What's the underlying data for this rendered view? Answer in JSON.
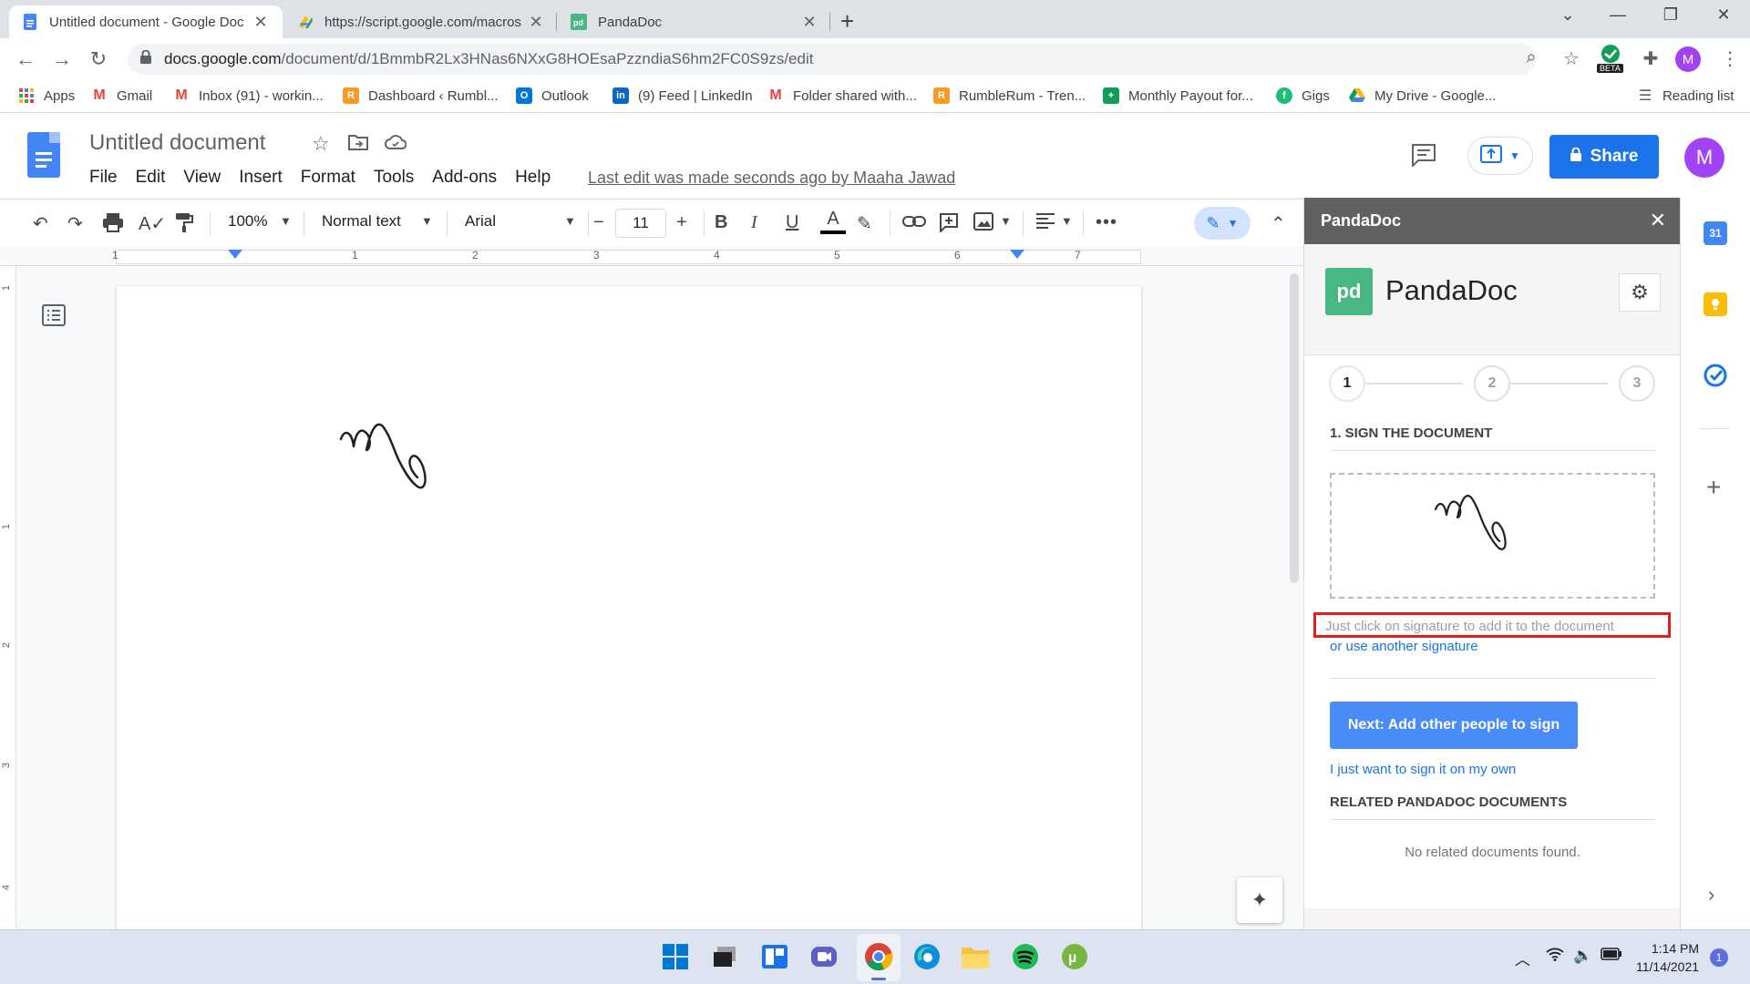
{
  "browser": {
    "tabs": [
      {
        "title": "Untitled document - Google Doc",
        "active": true
      },
      {
        "title": "https://script.google.com/macros",
        "active": false
      },
      {
        "title": "PandaDoc",
        "active": false
      }
    ],
    "url_host": "docs.google.com",
    "url_path": "/document/d/1BmmbR2Lx3HNas6NXxG8HOEsaPzzndiaS6hm2FC0S9zs/edit",
    "extension_badge": "BETA",
    "profile_initial": "M",
    "bookmarks": [
      {
        "label": "Apps",
        "icon": "apps-grid-icon",
        "color": "#4285f4"
      },
      {
        "label": "Gmail",
        "icon": "gmail-icon",
        "color": "#ea4335"
      },
      {
        "label": "Inbox (91) - workin...",
        "icon": "gmail-icon",
        "color": "#ea4335"
      },
      {
        "label": "Dashboard ‹ Rumbl...",
        "icon": "rumble-icon",
        "color": "#f59b23"
      },
      {
        "label": "Outlook",
        "icon": "outlook-icon",
        "color": "#0078d4"
      },
      {
        "label": "(9) Feed | LinkedIn",
        "icon": "linkedin-icon",
        "color": "#0a66c2"
      },
      {
        "label": "Folder shared with...",
        "icon": "gmail-icon",
        "color": "#ea4335"
      },
      {
        "label": "RumbleRum - Tren...",
        "icon": "rumble-icon",
        "color": "#f59b23"
      },
      {
        "label": "Monthly Payout for...",
        "icon": "sheets-icon",
        "color": "#0f9d58"
      },
      {
        "label": "Gigs",
        "icon": "gigs-icon",
        "color": "#1dbf73"
      },
      {
        "label": "My Drive - Google...",
        "icon": "drive-icon",
        "color": "#fbbc04"
      }
    ],
    "reading_list": "Reading list"
  },
  "docs": {
    "title": "Untitled document",
    "menus": [
      "File",
      "Edit",
      "View",
      "Insert",
      "Format",
      "Tools",
      "Add-ons",
      "Help"
    ],
    "last_edit": "Last edit was made seconds ago by Maaha Jawad",
    "share_label": "Share",
    "avatar_initial": "M",
    "toolbar": {
      "zoom": "100%",
      "style": "Normal text",
      "font": "Arial",
      "font_size": "11",
      "bold": "B",
      "italic": "I",
      "underline": "U",
      "text_color": "A"
    },
    "ruler_numbers": [
      "1",
      "1",
      "2",
      "3",
      "4",
      "5",
      "6",
      "7"
    ],
    "vruler_numbers": [
      "1",
      "1",
      "2",
      "3",
      "4"
    ]
  },
  "pandadoc": {
    "panel_title": "PandaDoc",
    "brand_name": "PandaDoc",
    "logo_text": "pd",
    "steps": [
      "1",
      "2",
      "3"
    ],
    "current_step": 1,
    "sign_heading": "1. SIGN THE DOCUMENT",
    "hint": "Just click on signature to add it to the document",
    "use_other": "or use another signature",
    "next_button": "Next: Add other people to sign",
    "sign_own": "I just want to sign it on my own",
    "related_heading": "RELATED PANDADOC DOCUMENTS",
    "no_related": "No related documents found.",
    "accent_color": "#47b881",
    "highlight_color": "#e0201c"
  },
  "rail": {
    "calendar_day": "31"
  },
  "taskbar": {
    "time": "1:14 PM",
    "date": "11/14/2021",
    "notifications": "1"
  }
}
